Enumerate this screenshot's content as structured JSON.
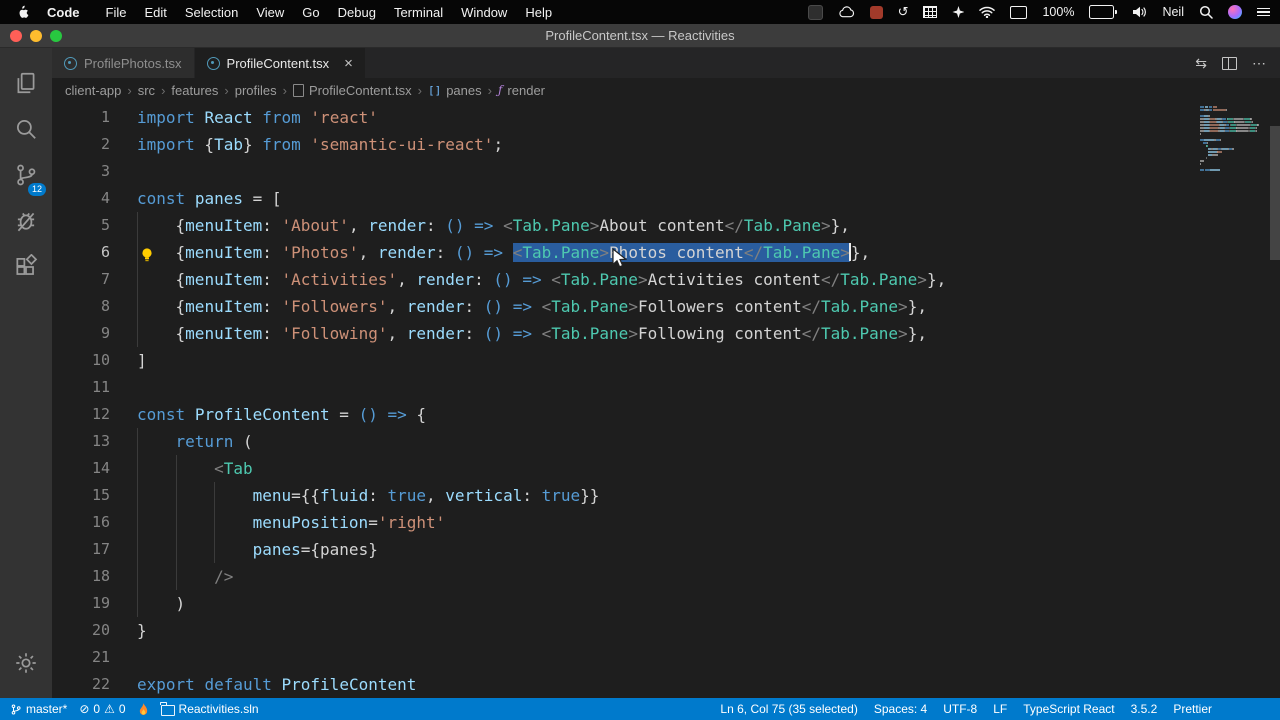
{
  "colors": {
    "accent": "#007acc",
    "statusbar_bg": "#007acc",
    "editor_bg": "#1e1e1e",
    "selection": "#2a5d9e",
    "activitybar_bg": "#333333"
  },
  "menubar": {
    "app": "Code",
    "items": [
      "File",
      "Edit",
      "Selection",
      "View",
      "Go",
      "Debug",
      "Terminal",
      "Window",
      "Help"
    ],
    "battery": "100%",
    "user": "Neil",
    "status_icons": [
      "tools-icon",
      "cloud-icon",
      "screen-record-icon",
      "time-machine-icon",
      "keyboard-grid-icon",
      "sparkle-icon",
      "wifi-icon",
      "display-icon",
      "battery-icon",
      "volume-icon",
      "spotlight-icon",
      "siri-icon",
      "control-center-icon"
    ],
    "time_machine_glyph": "↺"
  },
  "titlebar": {
    "title": "ProfileContent.tsx — Reactivities"
  },
  "editor_tabs": [
    {
      "label": "ProfilePhotos.tsx",
      "active": false
    },
    {
      "label": "ProfileContent.tsx",
      "active": true
    }
  ],
  "tab_actions": {
    "close": "×",
    "open_changes": "⇆",
    "more": "⋯"
  },
  "breadcrumb_separator": "›",
  "breadcrumbs": [
    {
      "label": "client-app"
    },
    {
      "label": "src"
    },
    {
      "label": "features"
    },
    {
      "label": "profiles"
    },
    {
      "label": "ProfileContent.tsx",
      "icon": "file-icon",
      "glyph": ""
    },
    {
      "label": "panes",
      "icon": "symbol-array-icon",
      "glyph": "[]"
    },
    {
      "label": "render",
      "icon": "symbol-field-icon",
      "glyph": "ƒ"
    }
  ],
  "activity_bar": {
    "scm_badge": "12"
  },
  "editor": {
    "active_line": 6,
    "lightbulb_line": 6,
    "lines": [
      {
        "n": 1,
        "indent": 0,
        "tokens": [
          [
            "import",
            "kw"
          ],
          [
            " ",
            "pln"
          ],
          [
            "React",
            "var"
          ],
          [
            " ",
            "pln"
          ],
          [
            "from",
            "kw"
          ],
          [
            " ",
            "pln"
          ],
          [
            "'react'",
            "str"
          ]
        ]
      },
      {
        "n": 2,
        "indent": 0,
        "tokens": [
          [
            "import",
            "kw"
          ],
          [
            " {",
            "pln"
          ],
          [
            "Tab",
            "var"
          ],
          [
            "} ",
            "pln"
          ],
          [
            "from",
            "kw"
          ],
          [
            " ",
            "pln"
          ],
          [
            "'semantic-ui-react'",
            "str"
          ],
          [
            ";",
            "pln"
          ]
        ]
      },
      {
        "n": 3,
        "indent": 0,
        "tokens": []
      },
      {
        "n": 4,
        "indent": 0,
        "tokens": [
          [
            "const",
            "kw"
          ],
          [
            " ",
            "pln"
          ],
          [
            "panes",
            "var"
          ],
          [
            " = [",
            "pln"
          ]
        ]
      },
      {
        "n": 5,
        "indent": 4,
        "tokens": [
          [
            "    {",
            "pln"
          ],
          [
            "menuItem",
            "var"
          ],
          [
            ": ",
            "pln"
          ],
          [
            "'About'",
            "str"
          ],
          [
            ", ",
            "pln"
          ],
          [
            "render",
            "var"
          ],
          [
            ": ",
            "pln"
          ],
          [
            "() =>",
            "kw"
          ],
          [
            " ",
            "pln"
          ],
          [
            "<",
            "brk"
          ],
          [
            "Tab.Pane",
            "tag"
          ],
          [
            ">",
            "brk"
          ],
          [
            "About content",
            "pln"
          ],
          [
            "</",
            "brk"
          ],
          [
            "Tab.Pane",
            "tag"
          ],
          [
            ">",
            "brk"
          ],
          [
            "},",
            "pln"
          ]
        ]
      },
      {
        "n": 6,
        "indent": 4,
        "tokens": [
          [
            "    {",
            "pln"
          ],
          [
            "menuItem",
            "var"
          ],
          [
            ": ",
            "pln"
          ],
          [
            "'Photos'",
            "str"
          ],
          [
            ", ",
            "pln"
          ],
          [
            "render",
            "var"
          ],
          [
            ": ",
            "pln"
          ],
          [
            "() =>",
            "kw"
          ],
          [
            " ",
            "pln"
          ],
          [
            "<",
            "brk",
            "sel"
          ],
          [
            "Tab.Pane",
            "tag",
            "sel"
          ],
          [
            ">",
            "brk",
            "sel"
          ],
          [
            "Photos content",
            "pln",
            "sel"
          ],
          [
            "</",
            "brk",
            "sel"
          ],
          [
            "Tab.Pane",
            "tag",
            "sel"
          ],
          [
            ">",
            "brk",
            "sel"
          ],
          [
            "",
            "caret"
          ],
          [
            "},",
            "pln"
          ]
        ]
      },
      {
        "n": 7,
        "indent": 4,
        "tokens": [
          [
            "    {",
            "pln"
          ],
          [
            "menuItem",
            "var"
          ],
          [
            ": ",
            "pln"
          ],
          [
            "'Activities'",
            "str"
          ],
          [
            ", ",
            "pln"
          ],
          [
            "render",
            "var"
          ],
          [
            ": ",
            "pln"
          ],
          [
            "() =>",
            "kw"
          ],
          [
            " ",
            "pln"
          ],
          [
            "<",
            "brk"
          ],
          [
            "Tab.Pane",
            "tag"
          ],
          [
            ">",
            "brk"
          ],
          [
            "Activities content",
            "pln"
          ],
          [
            "</",
            "brk"
          ],
          [
            "Tab.Pane",
            "tag"
          ],
          [
            ">",
            "brk"
          ],
          [
            "},",
            "pln"
          ]
        ]
      },
      {
        "n": 8,
        "indent": 4,
        "tokens": [
          [
            "    {",
            "pln"
          ],
          [
            "menuItem",
            "var"
          ],
          [
            ": ",
            "pln"
          ],
          [
            "'Followers'",
            "str"
          ],
          [
            ", ",
            "pln"
          ],
          [
            "render",
            "var"
          ],
          [
            ": ",
            "pln"
          ],
          [
            "() =>",
            "kw"
          ],
          [
            " ",
            "pln"
          ],
          [
            "<",
            "brk"
          ],
          [
            "Tab.Pane",
            "tag"
          ],
          [
            ">",
            "brk"
          ],
          [
            "Followers content",
            "pln"
          ],
          [
            "</",
            "brk"
          ],
          [
            "Tab.Pane",
            "tag"
          ],
          [
            ">",
            "brk"
          ],
          [
            "},",
            "pln"
          ]
        ]
      },
      {
        "n": 9,
        "indent": 4,
        "tokens": [
          [
            "    {",
            "pln"
          ],
          [
            "menuItem",
            "var"
          ],
          [
            ": ",
            "pln"
          ],
          [
            "'Following'",
            "str"
          ],
          [
            ", ",
            "pln"
          ],
          [
            "render",
            "var"
          ],
          [
            ": ",
            "pln"
          ],
          [
            "() =>",
            "kw"
          ],
          [
            " ",
            "pln"
          ],
          [
            "<",
            "brk"
          ],
          [
            "Tab.Pane",
            "tag"
          ],
          [
            ">",
            "brk"
          ],
          [
            "Following content",
            "pln"
          ],
          [
            "</",
            "brk"
          ],
          [
            "Tab.Pane",
            "tag"
          ],
          [
            ">",
            "brk"
          ],
          [
            "},",
            "pln"
          ]
        ]
      },
      {
        "n": 10,
        "indent": 0,
        "tokens": [
          [
            "]",
            "pln"
          ]
        ]
      },
      {
        "n": 11,
        "indent": 0,
        "tokens": []
      },
      {
        "n": 12,
        "indent": 0,
        "tokens": [
          [
            "const",
            "kw"
          ],
          [
            " ",
            "pln"
          ],
          [
            "ProfileContent",
            "var"
          ],
          [
            " = ",
            "pln"
          ],
          [
            "() =>",
            "kw"
          ],
          [
            " {",
            "pln"
          ]
        ]
      },
      {
        "n": 13,
        "indent": 4,
        "tokens": [
          [
            "    ",
            "pln"
          ],
          [
            "return",
            "kw"
          ],
          [
            " (",
            "pln"
          ]
        ]
      },
      {
        "n": 14,
        "indent": 8,
        "tokens": [
          [
            "        ",
            "pln"
          ],
          [
            "<",
            "brk"
          ],
          [
            "Tab",
            "tag"
          ],
          [
            " ",
            "pln"
          ]
        ]
      },
      {
        "n": 15,
        "indent": 12,
        "tokens": [
          [
            "            ",
            "pln"
          ],
          [
            "menu",
            "var"
          ],
          [
            "={{",
            "pln"
          ],
          [
            "fluid",
            "var"
          ],
          [
            ": ",
            "pln"
          ],
          [
            "true",
            "kw"
          ],
          [
            ", ",
            "pln"
          ],
          [
            "vertical",
            "var"
          ],
          [
            ": ",
            "pln"
          ],
          [
            "true",
            "kw"
          ],
          [
            "}}",
            "pln"
          ]
        ]
      },
      {
        "n": 16,
        "indent": 12,
        "tokens": [
          [
            "            ",
            "pln"
          ],
          [
            "menuPosition",
            "var"
          ],
          [
            "=",
            "pln"
          ],
          [
            "'right'",
            "str"
          ]
        ]
      },
      {
        "n": 17,
        "indent": 12,
        "tokens": [
          [
            "            ",
            "pln"
          ],
          [
            "panes",
            "var"
          ],
          [
            "={",
            "pln"
          ],
          [
            "panes",
            "pln"
          ],
          [
            "}",
            "pln"
          ]
        ]
      },
      {
        "n": 18,
        "indent": 8,
        "tokens": [
          [
            "        ",
            "pln"
          ],
          [
            "/>",
            "brk"
          ]
        ]
      },
      {
        "n": 19,
        "indent": 4,
        "tokens": [
          [
            "    )",
            "pln"
          ]
        ]
      },
      {
        "n": 20,
        "indent": 0,
        "tokens": [
          [
            "}",
            "pln"
          ]
        ]
      },
      {
        "n": 21,
        "indent": 0,
        "tokens": []
      },
      {
        "n": 22,
        "indent": 0,
        "tokens": [
          [
            "export",
            "kw"
          ],
          [
            " ",
            "pln"
          ],
          [
            "default",
            "kw"
          ],
          [
            " ",
            "pln"
          ],
          [
            "ProfileContent",
            "var"
          ]
        ]
      }
    ]
  },
  "statusbar": {
    "branch": "master*",
    "error_icon": "⊘",
    "errors": "0",
    "warning_icon": "⚠",
    "warnings": "0",
    "solution": "Reactivities.sln",
    "right": [
      "Ln 6, Col 75 (35 selected)",
      "Spaces: 4",
      "UTF-8",
      "LF",
      "TypeScript React",
      "3.5.2",
      "Prettier"
    ]
  }
}
